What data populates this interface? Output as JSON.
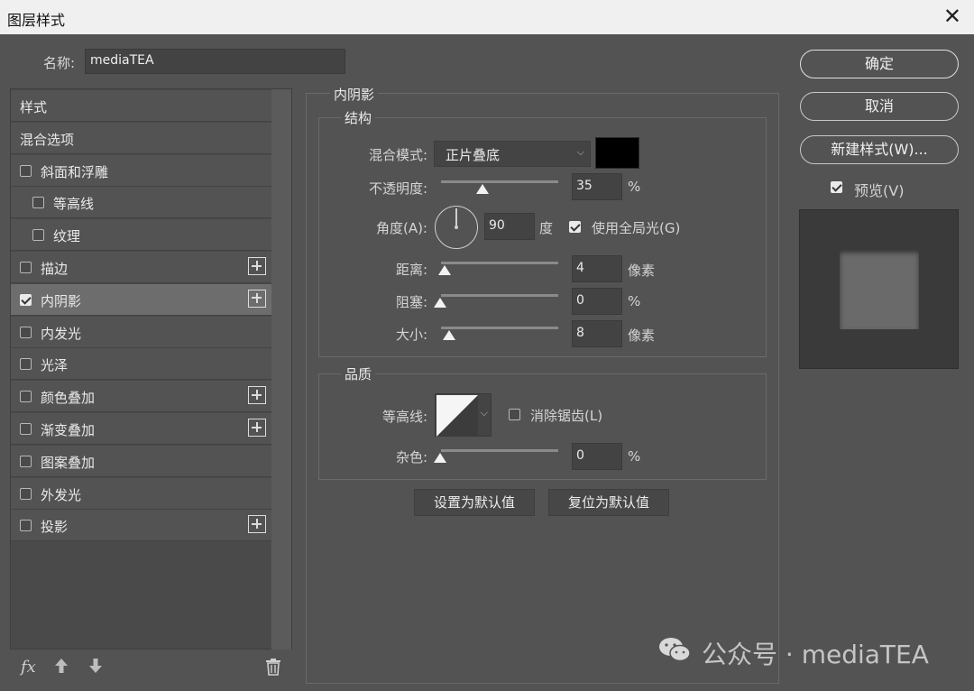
{
  "window": {
    "title": "图层样式",
    "close_glyph": "✕"
  },
  "name_row": {
    "label": "名称:",
    "value": "mediaTEA"
  },
  "left_list": {
    "items": [
      {
        "label": "样式",
        "has_check": false,
        "checked": false,
        "has_plus": false,
        "indent": false
      },
      {
        "label": "混合选项",
        "has_check": false,
        "checked": false,
        "has_plus": false,
        "indent": false
      },
      {
        "label": "斜面和浮雕",
        "has_check": true,
        "checked": false,
        "has_plus": false,
        "indent": false
      },
      {
        "label": "等高线",
        "has_check": true,
        "checked": false,
        "has_plus": false,
        "indent": true
      },
      {
        "label": "纹理",
        "has_check": true,
        "checked": false,
        "has_plus": false,
        "indent": true
      },
      {
        "label": "描边",
        "has_check": true,
        "checked": false,
        "has_plus": true,
        "indent": false
      },
      {
        "label": "内阴影",
        "has_check": true,
        "checked": true,
        "has_plus": true,
        "indent": false,
        "selected": true
      },
      {
        "label": "内发光",
        "has_check": true,
        "checked": false,
        "has_plus": false,
        "indent": false
      },
      {
        "label": "光泽",
        "has_check": true,
        "checked": false,
        "has_plus": false,
        "indent": false
      },
      {
        "label": "颜色叠加",
        "has_check": true,
        "checked": false,
        "has_plus": true,
        "indent": false
      },
      {
        "label": "渐变叠加",
        "has_check": true,
        "checked": false,
        "has_plus": true,
        "indent": false
      },
      {
        "label": "图案叠加",
        "has_check": true,
        "checked": false,
        "has_plus": false,
        "indent": false
      },
      {
        "label": "外发光",
        "has_check": true,
        "checked": false,
        "has_plus": false,
        "indent": false
      },
      {
        "label": "投影",
        "has_check": true,
        "checked": false,
        "has_plus": true,
        "indent": false
      }
    ],
    "footer": {
      "fx": "fx",
      "up_icon": "arrow-up-icon",
      "down_icon": "arrow-down-icon",
      "trash_icon": "trash-icon"
    }
  },
  "inner_shadow": {
    "section_title": "内阴影",
    "structure": {
      "title": "结构",
      "blend_mode_label": "混合模式:",
      "blend_mode_value": "正片叠底",
      "blend_color": "#000000",
      "opacity_label": "不透明度:",
      "opacity_value": "35",
      "opacity_unit": "%",
      "opacity_fraction": 0.35,
      "angle_label": "角度(A):",
      "angle_value": "90",
      "angle_unit": "度",
      "global_light_label": "使用全局光(G)",
      "global_light_checked": true,
      "distance_label": "距离:",
      "distance_value": "4",
      "distance_unit": "像素",
      "choke_label": "阻塞:",
      "choke_value": "0",
      "choke_unit": "%",
      "size_label": "大小:",
      "size_value": "8",
      "size_unit": "像素"
    },
    "quality": {
      "title": "品质",
      "contour_label": "等高线:",
      "antialias_label": "消除锯齿(L)",
      "antialias_checked": false,
      "noise_label": "杂色:",
      "noise_value": "0",
      "noise_unit": "%"
    },
    "buttons": {
      "set_default": "设置为默认值",
      "reset_default": "复位为默认值"
    }
  },
  "right_panel": {
    "ok": "确定",
    "cancel": "取消",
    "new_style": "新建样式(W)...",
    "preview_label": "预览(V)",
    "preview_checked": true
  },
  "watermark": {
    "text": "公众号 · mediaTEA",
    "icon": "wechat-icon"
  }
}
